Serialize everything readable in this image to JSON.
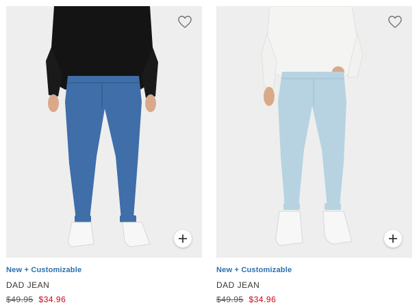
{
  "products": [
    {
      "badge": "New + Customizable",
      "name": "DAD JEAN",
      "original_price": "$49.95",
      "sale_price": "$34.96",
      "wash_color": "#3f6ea8",
      "top_color": "#161616"
    },
    {
      "badge": "New + Customizable",
      "name": "DAD JEAN",
      "original_price": "$49.95",
      "sale_price": "$34.96",
      "wash_color": "#b7d3e2",
      "top_color": "#f3f3f1"
    }
  ],
  "icons": {
    "wishlist": "heart-outline-icon",
    "quick_add": "plus-icon"
  },
  "colors": {
    "badge": "#2a6fb0",
    "sale": "#d0021b",
    "background": "#efefef"
  }
}
